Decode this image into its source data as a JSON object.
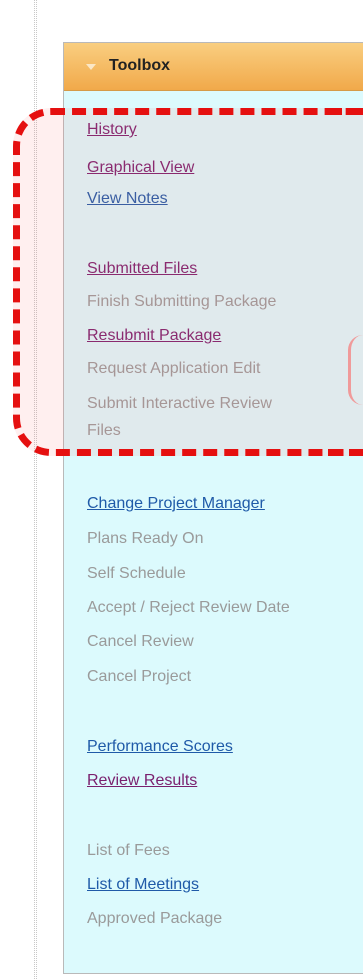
{
  "toolbox": {
    "title": "Toolbox",
    "items": [
      {
        "label": "History",
        "state": "link",
        "color": "#7a1f6e"
      },
      {
        "label": "Graphical View",
        "state": "link",
        "color": "#7a1f6e"
      },
      {
        "label": "View Notes",
        "state": "link",
        "color": "#1f5aa8"
      },
      {
        "label": "Submitted Files",
        "state": "link",
        "color": "#7a1f6e"
      },
      {
        "label": "Finish Submitting Package",
        "state": "disabled"
      },
      {
        "label": "Resubmit Package",
        "state": "link",
        "color": "#7a1f6e"
      },
      {
        "label": "Request Application Edit",
        "state": "disabled"
      },
      {
        "label": "Submit Interactive Review",
        "state": "disabled"
      },
      {
        "label": "Files",
        "state": "disabled"
      },
      {
        "label": "Change Project Manager",
        "state": "link",
        "color": "#1f5aa8"
      },
      {
        "label": "Plans Ready On",
        "state": "disabled"
      },
      {
        "label": "Self Schedule",
        "state": "disabled"
      },
      {
        "label": "Accept / Reject Review Date",
        "state": "disabled"
      },
      {
        "label": "Cancel Review",
        "state": "disabled"
      },
      {
        "label": "Cancel Project",
        "state": "disabled"
      },
      {
        "label": "Performance Scores",
        "state": "link",
        "color": "#1f5aa8"
      },
      {
        "label": "Review Results",
        "state": "link",
        "color": "#7a1f6e"
      },
      {
        "label": "List of Fees",
        "state": "disabled"
      },
      {
        "label": "List of Meetings",
        "state": "link",
        "color": "#1f5aa8"
      },
      {
        "label": "Approved Package",
        "state": "disabled"
      }
    ]
  },
  "highlight": {
    "color": "#e51010",
    "style": "dashed"
  },
  "colors": {
    "panel_background": "#dcfafd",
    "header_gradient_top": "#f9ce80",
    "header_gradient_bottom": "#f1a94a"
  }
}
